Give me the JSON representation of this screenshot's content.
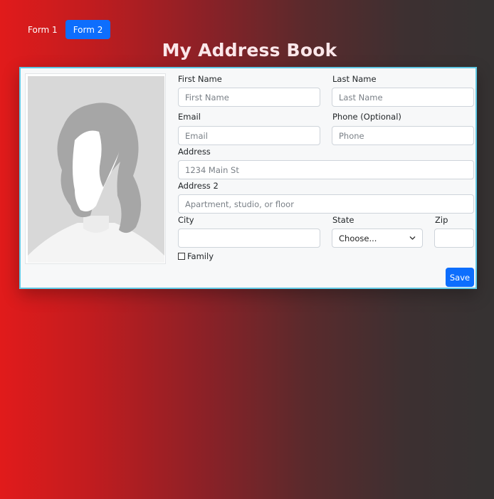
{
  "nav": {
    "tabs": [
      {
        "label": "Form 1",
        "active": false
      },
      {
        "label": "Form 2",
        "active": true
      }
    ]
  },
  "page": {
    "title": "My Address Book"
  },
  "form": {
    "first_name": {
      "label": "First Name",
      "placeholder": "First Name",
      "value": ""
    },
    "last_name": {
      "label": "Last Name",
      "placeholder": "Last Name",
      "value": ""
    },
    "email": {
      "label": "Email",
      "placeholder": "Email",
      "value": ""
    },
    "phone": {
      "label": "Phone (Optional)",
      "placeholder": "Phone",
      "value": ""
    },
    "address": {
      "label": "Address",
      "placeholder": "1234 Main St",
      "value": ""
    },
    "address2": {
      "label": "Address 2",
      "placeholder": "Apartment, studio, or floor",
      "value": ""
    },
    "city": {
      "label": "City",
      "placeholder": "",
      "value": ""
    },
    "state": {
      "label": "State",
      "selected": "Choose..."
    },
    "zip": {
      "label": "Zip",
      "placeholder": "",
      "value": ""
    },
    "family": {
      "label": "Family",
      "checked": false
    },
    "save_label": "Save"
  },
  "colors": {
    "accent": "#0d6efd",
    "card_border": "#5fc8e4",
    "card_bg": "#f7f8f9",
    "title": "#fbe7ea"
  },
  "icons": {
    "avatar": "female-avatar-placeholder-icon",
    "select": "chevron-down-icon"
  }
}
